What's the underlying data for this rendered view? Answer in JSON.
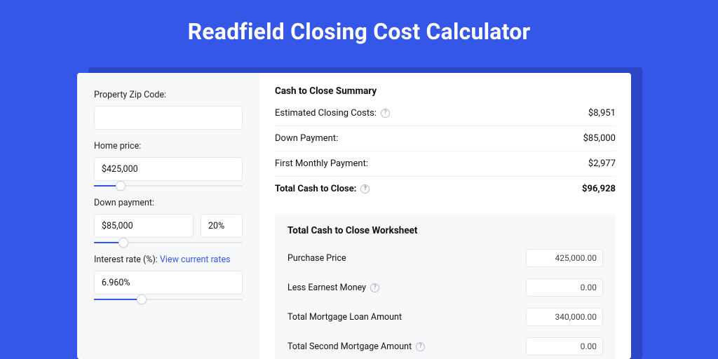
{
  "page_title": "Readfield Closing Cost Calculator",
  "sidebar": {
    "zip_label": "Property Zip Code:",
    "zip_value": "",
    "home_price_label": "Home price:",
    "home_price_value": "$425,000",
    "home_price_slider_percent": 18,
    "down_payment_label": "Down payment:",
    "down_payment_value": "$85,000",
    "down_payment_pct_value": "20%",
    "down_payment_slider_percent": 20,
    "interest_label_prefix": "Interest rate (%): ",
    "interest_link": "View current rates",
    "interest_value": "6.960%",
    "interest_slider_percent": 32
  },
  "summary": {
    "title": "Cash to Close Summary",
    "rows": [
      {
        "label": "Estimated Closing Costs:",
        "help": true,
        "value": "$8,951",
        "bold": false
      },
      {
        "label": "Down Payment:",
        "help": false,
        "value": "$85,000",
        "bold": false
      },
      {
        "label": "First Monthly Payment:",
        "help": false,
        "value": "$2,977",
        "bold": false
      },
      {
        "label": "Total Cash to Close:",
        "help": true,
        "value": "$96,928",
        "bold": true
      }
    ]
  },
  "worksheet": {
    "title": "Total Cash to Close Worksheet",
    "rows": [
      {
        "label": "Purchase Price",
        "help": false,
        "value": "425,000.00"
      },
      {
        "label": "Less Earnest Money",
        "help": true,
        "value": "0.00"
      },
      {
        "label": "Total Mortgage Loan Amount",
        "help": false,
        "value": "340,000.00"
      },
      {
        "label": "Total Second Mortgage Amount",
        "help": true,
        "value": "0.00"
      }
    ]
  }
}
